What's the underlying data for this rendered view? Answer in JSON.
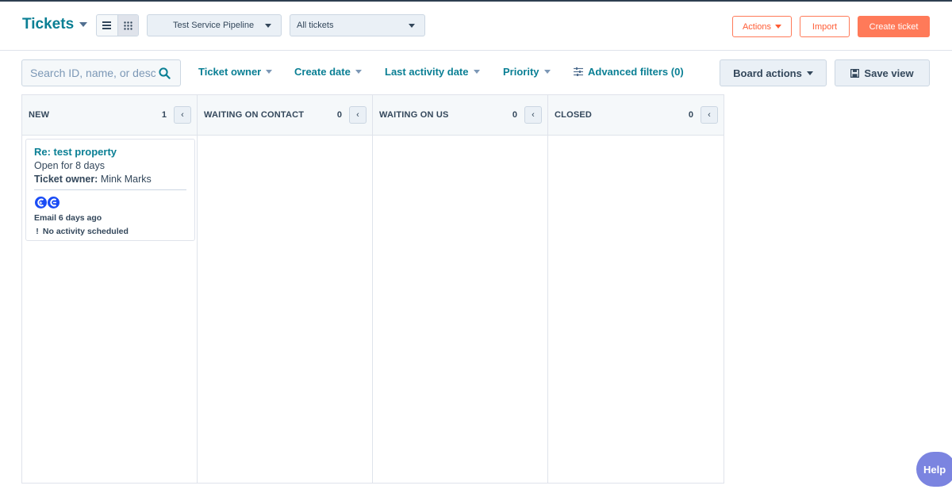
{
  "header": {
    "title": "Tickets",
    "pipeline_select": "Test Service Pipeline",
    "view_select": "All tickets",
    "actions_label": "Actions",
    "import_label": "Import",
    "create_label": "Create ticket"
  },
  "filters": {
    "search_placeholder": "Search ID, name, or description",
    "ticket_owner": "Ticket owner",
    "create_date": "Create date",
    "last_activity_date": "Last activity date",
    "priority": "Priority",
    "advanced_filters": "Advanced filters (0)",
    "board_actions": "Board actions",
    "save_view": "Save view"
  },
  "board": {
    "columns": [
      {
        "name": "NEW",
        "count": "1"
      },
      {
        "name": "WAITING ON CONTACT",
        "count": "0"
      },
      {
        "name": "WAITING ON US",
        "count": "0"
      },
      {
        "name": "CLOSED",
        "count": "0"
      }
    ],
    "card": {
      "title": "Re: test property",
      "open_for": "Open for 8 days",
      "owner_label": "Ticket owner:",
      "owner_name": "Mink Marks",
      "last_email": "Email 6 days ago",
      "warning_icon": "!",
      "no_activity": "No activity scheduled"
    }
  },
  "help": {
    "label": "Help"
  },
  "colors": {
    "accent": "#0a7f94",
    "primary_button": "#ff7a59",
    "avatar": "#1a4cf5"
  }
}
